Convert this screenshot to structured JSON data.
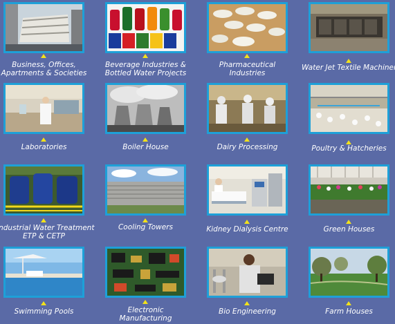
{
  "tiles": [
    {
      "label1": "Business, Offices,",
      "label2": "Apartments & Societies",
      "icon": "building-photo"
    },
    {
      "label1": "Beverage Industries &",
      "label2": "Bottled Water Projects",
      "icon": "bottles-photo"
    },
    {
      "label1": "Pharmaceutical",
      "label2": "Industries",
      "icon": "pills-photo"
    },
    {
      "label1": "Water Jet Textile Machinery",
      "label2": "",
      "icon": "textile-machinery-photo"
    },
    {
      "label1": "Laboratories",
      "label2": "",
      "icon": "laboratory-photo"
    },
    {
      "label1": "Boiler House",
      "label2": "",
      "icon": "boiler-house-photo"
    },
    {
      "label1": "Dairy Processing",
      "label2": "",
      "icon": "dairy-photo"
    },
    {
      "label1": "Poultry & Hatcheries",
      "label2": "",
      "icon": "poultry-photo"
    },
    {
      "label1": "Industrial Water Treatment",
      "label2": "ETP & CETP",
      "icon": "water-treatment-photo"
    },
    {
      "label1": "Cooling Towers",
      "label2": "",
      "icon": "cooling-towers-photo"
    },
    {
      "label1": "Kidney Dialysis Centre",
      "label2": "",
      "icon": "dialysis-photo"
    },
    {
      "label1": "Green Houses",
      "label2": "",
      "icon": "greenhouse-photo"
    },
    {
      "label1": "Swimming Pools",
      "label2": "",
      "icon": "pool-photo"
    },
    {
      "label1": "Electronic",
      "label2": "Manufacturing",
      "icon": "circuit-board-photo"
    },
    {
      "label1": "Bio Engineering",
      "label2": "",
      "icon": "bio-engineering-photo"
    },
    {
      "label1": "Farm Houses",
      "label2": "",
      "icon": "farm-photo"
    }
  ]
}
